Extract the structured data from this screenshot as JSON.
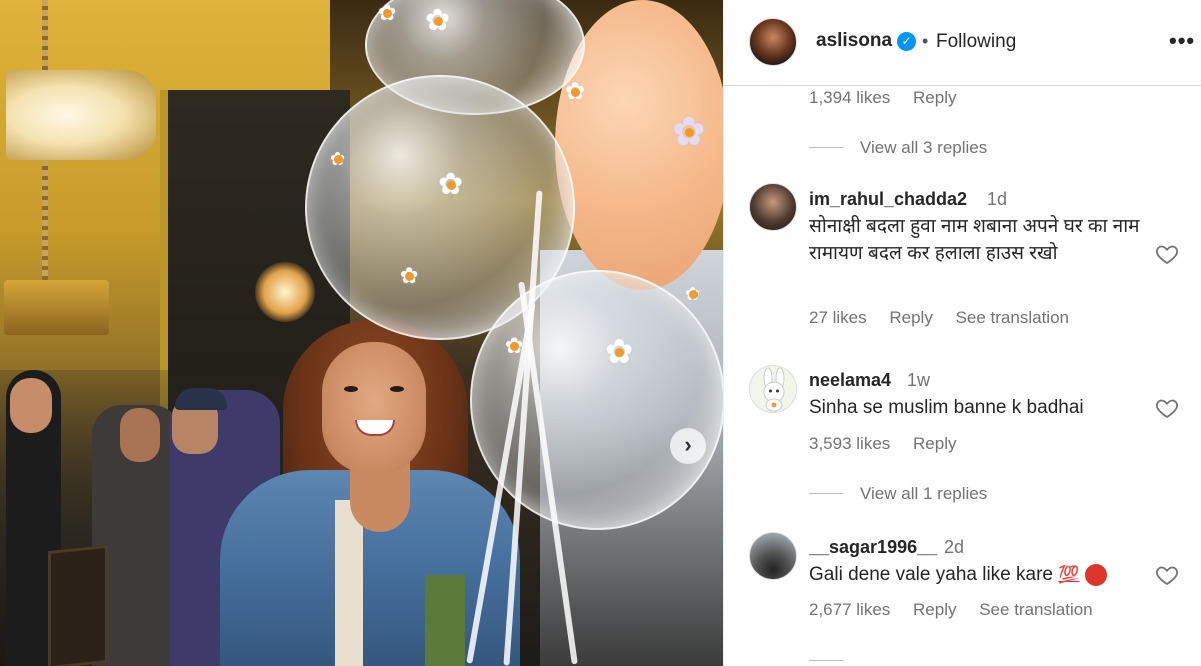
{
  "post": {
    "carousel_next_icon": "chevron-right-icon"
  },
  "header": {
    "username": "aslisona",
    "verified_icon": "verified-badge-icon",
    "separator": "•",
    "follow_status": "Following",
    "more_icon": "ellipsis-icon",
    "more_label": "•••"
  },
  "prev_comment": {
    "likes": "1,394 likes",
    "reply": "Reply"
  },
  "view_replies_1": "View all 3 replies",
  "comments": [
    {
      "username": "im_rahul_chadda2",
      "time": "1d",
      "text": "सोनाक्षी बदला हुवा नाम शबाना अपने घर का नाम रामायण बदल कर हलाला हाउस रखो",
      "likes": "27 likes",
      "reply": "Reply",
      "translation": "See translation"
    },
    {
      "username": "neelama4",
      "time": "1w",
      "text": "Sinha se muslim banne k badhai",
      "likes": "3,593 likes",
      "reply": "Reply"
    },
    {
      "username": "__sagar1996__",
      "time": "2d",
      "text": "Gali dene vale yaha like kare",
      "emoji_1": "💯",
      "likes": "2,677 likes",
      "reply": "Reply",
      "translation": "See translation"
    }
  ],
  "view_replies_2": "View all 1 replies",
  "colors": {
    "accent": "#0095f6",
    "text": "#262626",
    "muted": "#737373"
  }
}
